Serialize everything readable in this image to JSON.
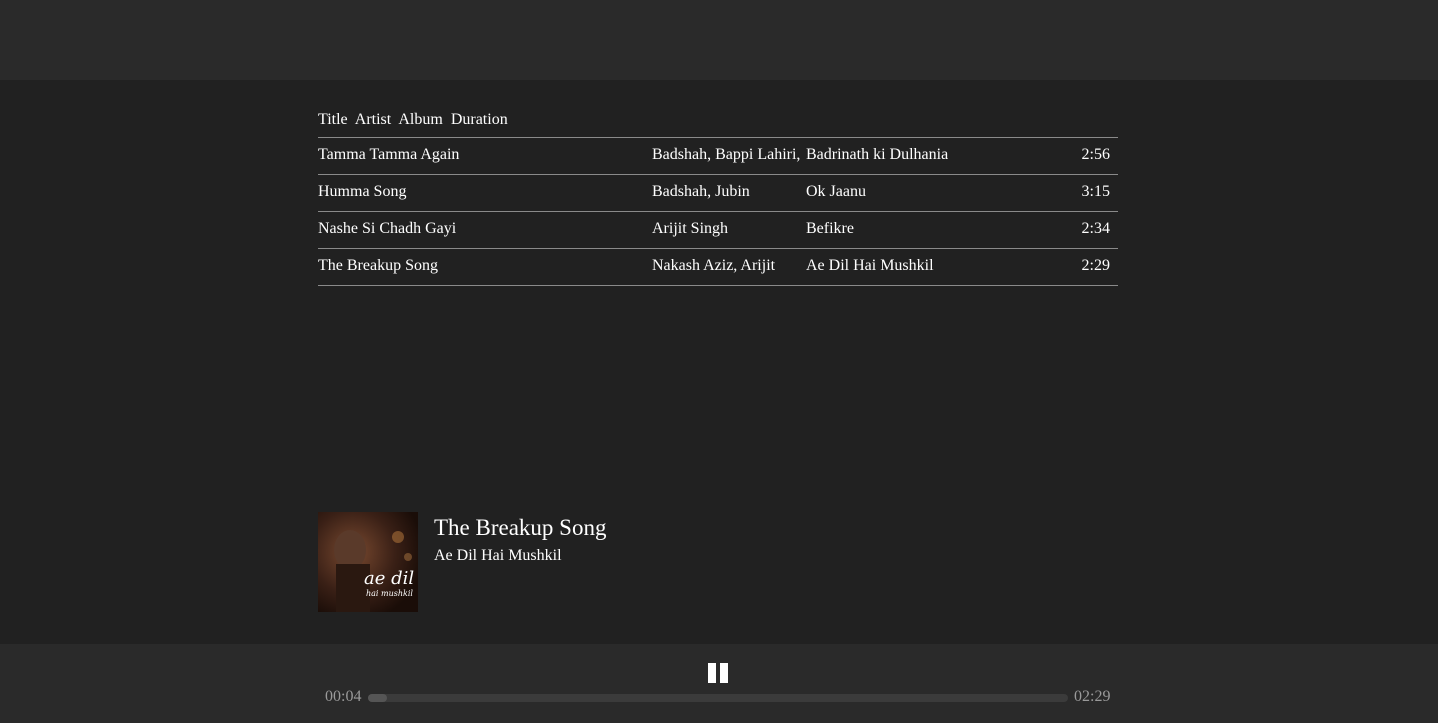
{
  "table": {
    "headers": [
      "Title",
      "Artist",
      "Album",
      "Duration"
    ],
    "rows": [
      {
        "title": "Tamma Tamma Again",
        "artist": "Badshah, Bappi Lahiri,",
        "album": "Badrinath ki Dulhania",
        "duration": "2:56"
      },
      {
        "title": "Humma Song",
        "artist": "Badshah, Jubin",
        "album": "Ok Jaanu",
        "duration": "3:15"
      },
      {
        "title": "Nashe Si Chadh Gayi",
        "artist": "Arijit Singh",
        "album": "Befikre",
        "duration": "2:34"
      },
      {
        "title": "The Breakup Song",
        "artist": "Nakash Aziz, Arijit",
        "album": "Ae Dil Hai Mushkil",
        "duration": "2:29"
      }
    ]
  },
  "now_playing": {
    "title": "The Breakup Song",
    "album": "Ae Dil Hai Mushkil",
    "art_text": "ae dil",
    "art_subtext": "hai mushkil"
  },
  "player": {
    "current_time": "00:04",
    "total_time": "02:29",
    "progress": 0.027,
    "state_icon": "pause-icon"
  },
  "colors": {
    "background": "#212121",
    "bars": "#2a2a2a",
    "divider": "#8a8a8a",
    "accent_pink": "#e0306a"
  }
}
